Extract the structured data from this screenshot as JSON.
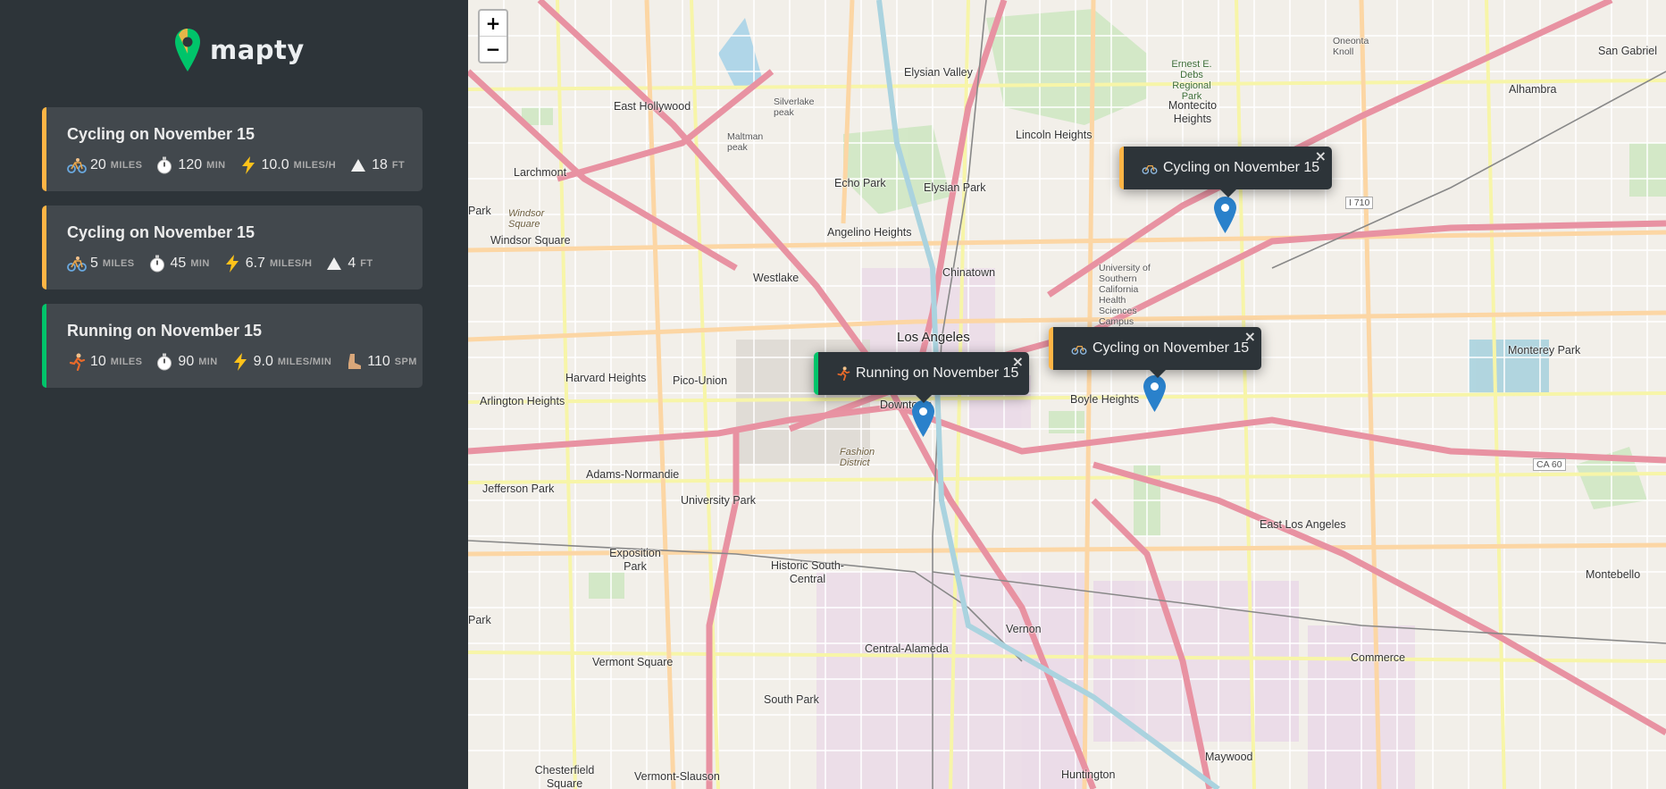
{
  "app": {
    "name": "mapty"
  },
  "workouts": [
    {
      "title": "Cycling on November 15",
      "type": "cycling",
      "distance": "20",
      "distance_unit": "miles",
      "duration": "120",
      "duration_unit": "min",
      "speed": "10.0",
      "speed_unit": "miles/h",
      "extra": "18",
      "extra_unit": "ft"
    },
    {
      "title": "Cycling on November 15",
      "type": "cycling",
      "distance": "5",
      "distance_unit": "miles",
      "duration": "45",
      "duration_unit": "min",
      "speed": "6.7",
      "speed_unit": "miles/h",
      "extra": "4",
      "extra_unit": "ft"
    },
    {
      "title": "Running on November 15",
      "type": "running",
      "distance": "10",
      "distance_unit": "miles",
      "duration": "90",
      "duration_unit": "min",
      "speed": "9.0",
      "speed_unit": "miles/min",
      "extra": "110",
      "extra_unit": "spm"
    }
  ],
  "map": {
    "zoom_in": "+",
    "zoom_out": "−",
    "popups": [
      {
        "label": "Cycling on November 15",
        "type": "cycling",
        "close": "×"
      },
      {
        "label": "Cycling on November 15",
        "type": "cycling",
        "close": "×"
      },
      {
        "label": "Running on November 15",
        "type": "running",
        "close": "×"
      }
    ],
    "labels": {
      "la": "Los Angeles",
      "east_hollywood": "East Hollywood",
      "silver_lake": "Silverlake peak",
      "elysian_valley": "Elysian Valley",
      "lincoln_heights": "Lincoln Heights",
      "montecito": "Montecito Heights",
      "alhambra": "Alhambra",
      "san_gabriel": "San Gabriel",
      "larchmont": "Larchmont",
      "echo_park": "Echo Park",
      "elysian_park": "Elysian Park",
      "angelino_heights": "Angelino Heights",
      "windsor_square_it": "Windsor Square",
      "windsor_square": "Windsor Square",
      "westlake": "Westlake",
      "chinatown": "Chinatown",
      "harvard_heights": "Harvard Heights",
      "pico_union": "Pico-Union",
      "arlington_heights": "Arlington Heights",
      "downtown": "Downtown",
      "fashion_district": "Fashion District",
      "boyle_heights": "Boyle Heights",
      "monterey_park": "Monterey Park",
      "adams_normandie": "Adams-Normandie",
      "jefferson_park": "Jefferson Park",
      "university_park": "University Park",
      "exposition_park": "Exposition Park",
      "historic_south_central": "Historic South-Central",
      "east_la": "East Los Angeles",
      "montebello": "Montebello",
      "commerce": "Commerce",
      "vernon": "Vernon",
      "central_alameda": "Central-Alameda",
      "vermont_square": "Vermont Square",
      "south_park": "South Park",
      "maywood": "Maywood",
      "huntington": "Huntington",
      "chesterfield": "Chesterfield Square",
      "vermont_slauson": "Vermont-Slauson",
      "oneonta": "Oneonta Knoll",
      "ernest_debs": "Ernest E. Debs Regional Park",
      "usc_health": "University of Southern California Health Sciences Campus",
      "maltman": "Maltman peak",
      "park_left": "Park",
      "park_left2": "Park",
      "i710": "I 710",
      "ca60": "CA 60"
    }
  }
}
